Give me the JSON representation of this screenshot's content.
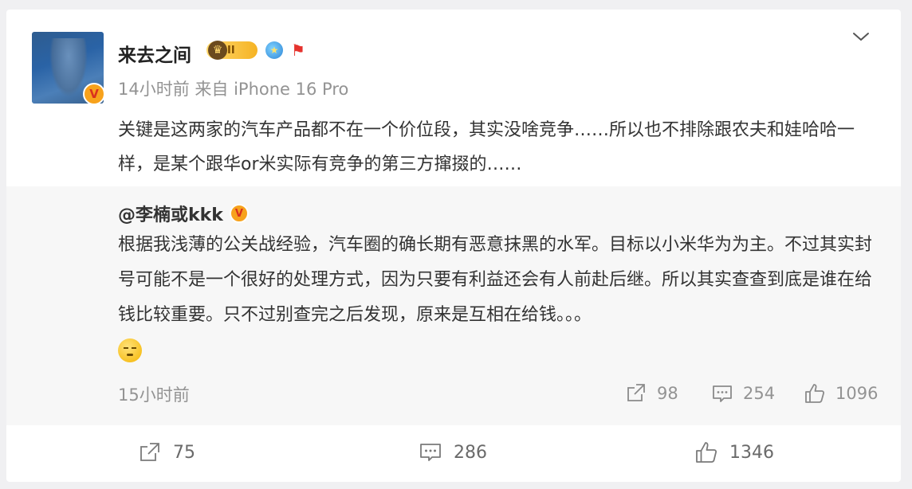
{
  "post": {
    "username": "来去之间",
    "level_badge": "II",
    "meta": "14小时前 来自 iPhone 16 Pro",
    "text": "关键是这两家的汽车产品都不在一个价位段，其实没啥竞争……所以也不排除跟农夫和娃哈哈一样，是某个跟华or米实际有竞争的第三方撺掇的……",
    "verified_mark": "V"
  },
  "repost": {
    "author": "@李楠或kkk",
    "verified_mark": "V",
    "text": "根据我浅薄的公关战经验，汽车圈的确长期有恶意抹黑的水军。目标以小米华为为主。不过其实封号可能不是一个很好的处理方式，因为只要有利益还会有人前赴后继。所以其实查查到底是谁在给钱比较重要。只不过别查完之后发现，原来是互相在给钱。。。",
    "time": "15小时前",
    "reposts": "98",
    "comments": "254",
    "likes": "1096"
  },
  "actions": {
    "reposts": "75",
    "comments": "286",
    "likes": "1346"
  },
  "icons": {
    "chevron": "chevron-down-icon",
    "repost": "repost-icon",
    "comment": "comment-icon",
    "like": "like-icon",
    "emoji": "smirk-emoji-icon"
  },
  "colors": {
    "text_primary": "#333333",
    "text_secondary": "#939393",
    "repost_bg": "#f7f7f7",
    "verified_badge": "#f7a21c"
  }
}
